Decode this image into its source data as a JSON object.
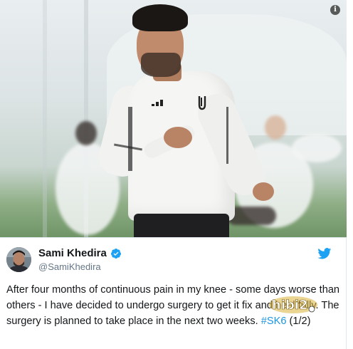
{
  "media": {
    "info_label": "i",
    "watermark_text": "hibi2"
  },
  "tweet": {
    "display_name": "Sami Khedira",
    "handle": "@SamiKhedira",
    "text_main": "After four months of continuous pain in my knee - some days worse than others - I have decided to undergo surgery to get it fix and heal fully. The surgery is planned to take place in the next two weeks. ",
    "hashtag": "#SK6",
    "text_suffix": " (1/2)"
  },
  "colors": {
    "link": "#1b95e0",
    "verified": "#1da1f2",
    "twitter_bird": "#1da1f2",
    "handle_gray": "#657786"
  },
  "icons": {
    "verified": "verified-badge-icon",
    "twitter": "twitter-bird-icon",
    "info": "info-icon"
  }
}
